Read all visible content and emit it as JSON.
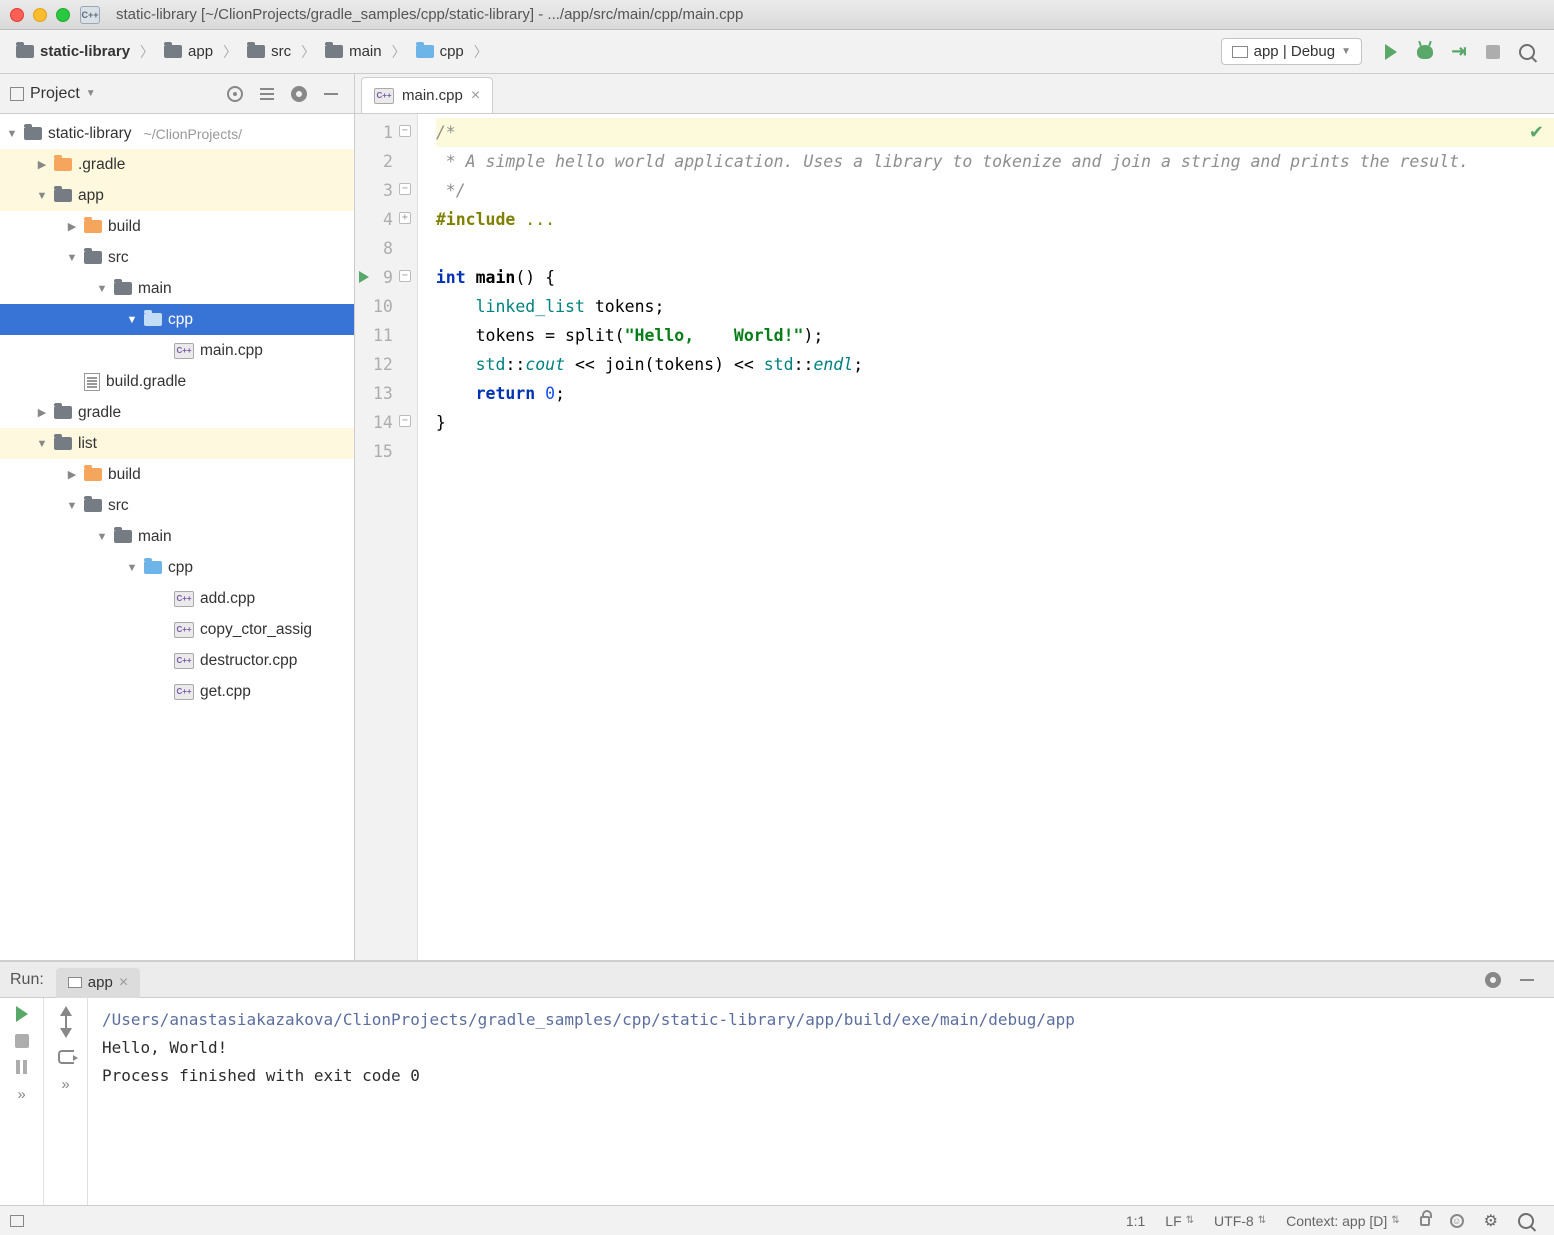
{
  "titlebar": {
    "title": "static-library [~/ClionProjects/gradle_samples/cpp/static-library] - .../app/src/main/cpp/main.cpp"
  },
  "breadcrumbs": [
    "static-library",
    "app",
    "src",
    "main",
    "cpp"
  ],
  "run_config": "app | Debug",
  "sidebar": {
    "title": "Project",
    "tree": [
      {
        "depth": 0,
        "arrow": "v",
        "icon": "folder-dark",
        "label": "static-library",
        "hint": "~/ClionProjects/"
      },
      {
        "depth": 1,
        "arrow": ">",
        "icon": "folder-orange",
        "label": ".gradle",
        "hl": true
      },
      {
        "depth": 1,
        "arrow": "v",
        "icon": "folder-dark",
        "label": "app",
        "hl": true
      },
      {
        "depth": 2,
        "arrow": ">",
        "icon": "folder-orange",
        "label": "build"
      },
      {
        "depth": 2,
        "arrow": "v",
        "icon": "folder-dark",
        "label": "src"
      },
      {
        "depth": 3,
        "arrow": "v",
        "icon": "folder-dark",
        "label": "main"
      },
      {
        "depth": 4,
        "arrow": "v",
        "icon": "folder-blue",
        "label": "cpp",
        "selected": true
      },
      {
        "depth": 5,
        "arrow": "",
        "icon": "cpp",
        "label": "main.cpp"
      },
      {
        "depth": 2,
        "arrow": "",
        "icon": "gradle",
        "label": "build.gradle"
      },
      {
        "depth": 1,
        "arrow": ">",
        "icon": "folder-dark",
        "label": "gradle"
      },
      {
        "depth": 1,
        "arrow": "v",
        "icon": "folder-dark",
        "label": "list",
        "hl": true
      },
      {
        "depth": 2,
        "arrow": ">",
        "icon": "folder-orange",
        "label": "build"
      },
      {
        "depth": 2,
        "arrow": "v",
        "icon": "folder-dark",
        "label": "src"
      },
      {
        "depth": 3,
        "arrow": "v",
        "icon": "folder-dark",
        "label": "main"
      },
      {
        "depth": 4,
        "arrow": "v",
        "icon": "folder-blue",
        "label": "cpp"
      },
      {
        "depth": 5,
        "arrow": "",
        "icon": "cpp",
        "label": "add.cpp"
      },
      {
        "depth": 5,
        "arrow": "",
        "icon": "cpp",
        "label": "copy_ctor_assig"
      },
      {
        "depth": 5,
        "arrow": "",
        "icon": "cpp",
        "label": "destructor.cpp"
      },
      {
        "depth": 5,
        "arrow": "",
        "icon": "cpp",
        "label": "get.cpp"
      }
    ]
  },
  "editor": {
    "tab": "main.cpp",
    "lines": [
      {
        "n": 1,
        "hl": true,
        "fold": "-",
        "tokens": [
          {
            "t": "/*",
            "c": "comment"
          }
        ]
      },
      {
        "n": 2,
        "tokens": [
          {
            "t": " * A simple hello world application. Uses a library to tokenize and join a string and prints the result.",
            "c": "comment"
          }
        ]
      },
      {
        "n": 3,
        "fold": "-",
        "tokens": [
          {
            "t": " */",
            "c": "comment"
          }
        ]
      },
      {
        "n": 4,
        "fold": "+",
        "tokens": [
          {
            "t": "#include ",
            "c": "pp"
          },
          {
            "t": "...",
            "c": "pp-dim"
          }
        ]
      },
      {
        "n": 8,
        "tokens": []
      },
      {
        "n": 9,
        "run": true,
        "fold": "-",
        "tokens": [
          {
            "t": "int ",
            "c": "keyword"
          },
          {
            "t": "main",
            "c": "func"
          },
          {
            "t": "() {",
            "c": "paren"
          }
        ]
      },
      {
        "n": 10,
        "tokens": [
          {
            "t": "    ",
            "c": ""
          },
          {
            "t": "linked_list",
            "c": "type"
          },
          {
            "t": " tokens;",
            "c": "op"
          }
        ]
      },
      {
        "n": 11,
        "tokens": [
          {
            "t": "    tokens = split(",
            "c": "op"
          },
          {
            "t": "\"Hello,    World!\"",
            "c": "string"
          },
          {
            "t": ");",
            "c": "op"
          }
        ]
      },
      {
        "n": 12,
        "tokens": [
          {
            "t": "    ",
            "c": ""
          },
          {
            "t": "std",
            "c": "type"
          },
          {
            "t": "::",
            "c": "op"
          },
          {
            "t": "cout",
            "c": "inherit"
          },
          {
            "t": " << join(tokens) << ",
            "c": "op"
          },
          {
            "t": "std",
            "c": "type"
          },
          {
            "t": "::",
            "c": "op"
          },
          {
            "t": "endl",
            "c": "inherit"
          },
          {
            "t": ";",
            "c": "op"
          }
        ]
      },
      {
        "n": 13,
        "tokens": [
          {
            "t": "    ",
            "c": ""
          },
          {
            "t": "return ",
            "c": "keyword"
          },
          {
            "t": "0",
            "c": "number"
          },
          {
            "t": ";",
            "c": "op"
          }
        ]
      },
      {
        "n": 14,
        "fold": "-",
        "tokens": [
          {
            "t": "}",
            "c": "paren"
          }
        ]
      },
      {
        "n": 15,
        "tokens": []
      }
    ]
  },
  "run": {
    "title": "Run:",
    "tab": "app",
    "output": {
      "path": "/Users/anastasiakazakova/ClionProjects/gradle_samples/cpp/static-library/app/build/exe/main/debug/app",
      "line1": "Hello, World!",
      "line2": "",
      "line3": "Process finished with exit code 0"
    }
  },
  "statusbar": {
    "pos": "1:1",
    "le": "LF",
    "enc": "UTF-8",
    "ctx": "Context: app [D]"
  }
}
